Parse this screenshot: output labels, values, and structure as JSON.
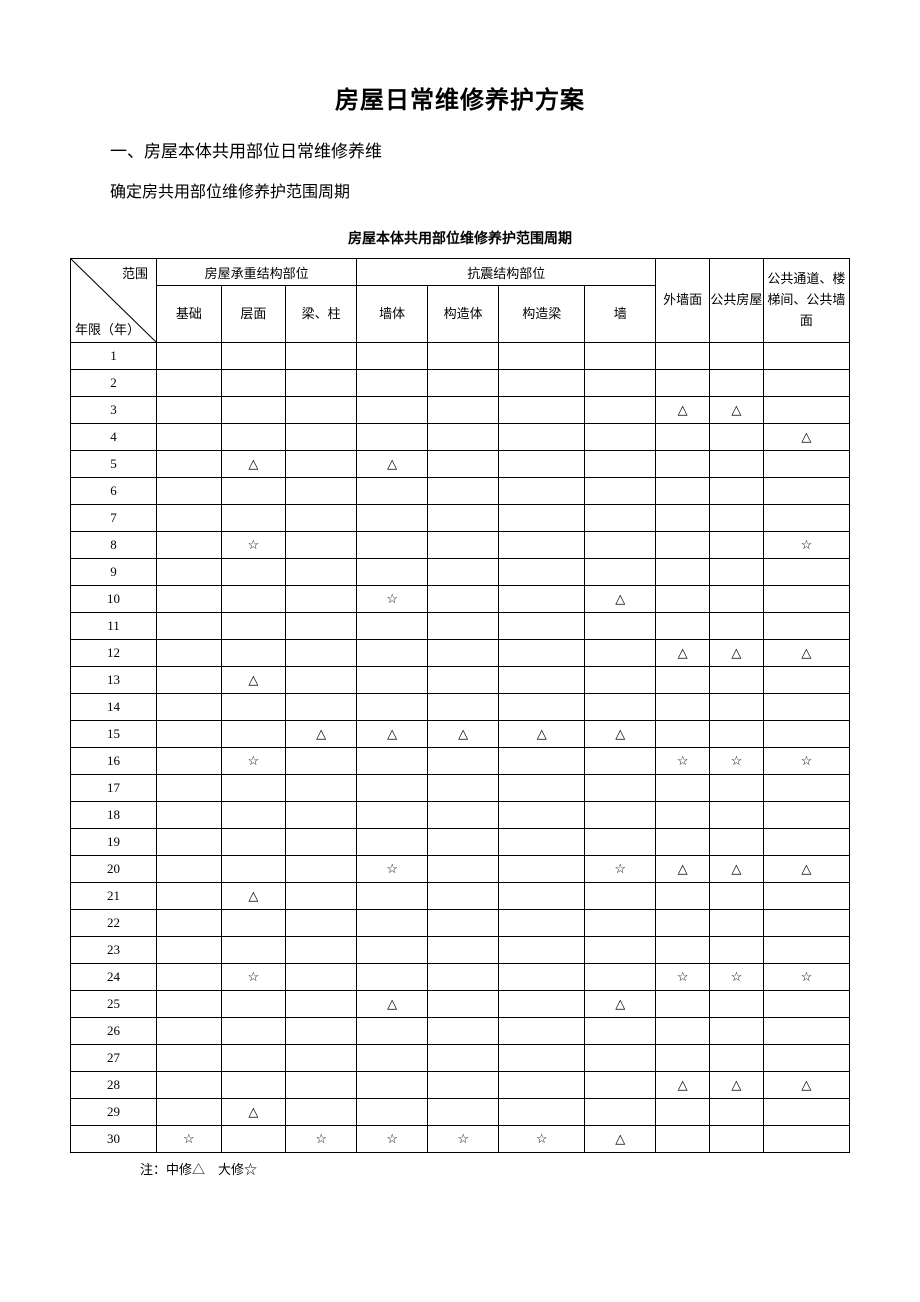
{
  "title": "房屋日常维修养护方案",
  "section_heading": "一、房屋本体共用部位日常维修养维",
  "subtext": "确定房共用部位维修养护范围周期",
  "table_caption": "房屋本体共用部位维修养护范围周期",
  "diag": {
    "top": "范围",
    "bottom": "年限（年）"
  },
  "header_groups": {
    "g1": "房屋承重结构部位",
    "g2": "抗震结构部位"
  },
  "columns": {
    "c1": "基础",
    "c2": "层面",
    "c3": "梁、柱",
    "c4": "墙体",
    "c5": "构造体",
    "c6": "构造梁",
    "c7": "墙",
    "c8": "外墙面",
    "c9": "公共房屋",
    "c10": "公共通道、楼梯间、公共墙面"
  },
  "symbols": {
    "mid": "△",
    "big": "☆"
  },
  "legend": "注：中修△    大修☆",
  "chart_data": {
    "type": "table",
    "legend": {
      "△": "中修",
      "☆": "大修"
    },
    "columns": [
      "基础",
      "层面",
      "梁、柱",
      "墙体",
      "构造体",
      "构造梁",
      "墙",
      "外墙面",
      "公共房屋",
      "公共通道、楼梯间、公共墙面"
    ],
    "rows": [
      {
        "year": 1,
        "cells": [
          "",
          "",
          "",
          "",
          "",
          "",
          "",
          "",
          "",
          ""
        ]
      },
      {
        "year": 2,
        "cells": [
          "",
          "",
          "",
          "",
          "",
          "",
          "",
          "",
          "",
          ""
        ]
      },
      {
        "year": 3,
        "cells": [
          "",
          "",
          "",
          "",
          "",
          "",
          "",
          "△",
          "△",
          ""
        ]
      },
      {
        "year": 4,
        "cells": [
          "",
          "",
          "",
          "",
          "",
          "",
          "",
          "",
          "",
          "△"
        ]
      },
      {
        "year": 5,
        "cells": [
          "",
          "△",
          "",
          "△",
          "",
          "",
          "",
          "",
          "",
          ""
        ]
      },
      {
        "year": 6,
        "cells": [
          "",
          "",
          "",
          "",
          "",
          "",
          "",
          "",
          "",
          ""
        ]
      },
      {
        "year": 7,
        "cells": [
          "",
          "",
          "",
          "",
          "",
          "",
          "",
          "",
          "",
          ""
        ]
      },
      {
        "year": 8,
        "cells": [
          "",
          "☆",
          "",
          "",
          "",
          "",
          "",
          "",
          "",
          "☆"
        ]
      },
      {
        "year": 9,
        "cells": [
          "",
          "",
          "",
          "",
          "",
          "",
          "",
          "",
          "",
          ""
        ]
      },
      {
        "year": 10,
        "cells": [
          "",
          "",
          "",
          "☆",
          "",
          "",
          "△",
          "",
          "",
          ""
        ]
      },
      {
        "year": 11,
        "cells": [
          "",
          "",
          "",
          "",
          "",
          "",
          "",
          "",
          "",
          ""
        ]
      },
      {
        "year": 12,
        "cells": [
          "",
          "",
          "",
          "",
          "",
          "",
          "",
          "△",
          "△",
          "△"
        ]
      },
      {
        "year": 13,
        "cells": [
          "",
          "△",
          "",
          "",
          "",
          "",
          "",
          "",
          "",
          ""
        ]
      },
      {
        "year": 14,
        "cells": [
          "",
          "",
          "",
          "",
          "",
          "",
          "",
          "",
          "",
          ""
        ]
      },
      {
        "year": 15,
        "cells": [
          "",
          "",
          "△",
          "△",
          "△",
          "△",
          "△",
          "",
          "",
          ""
        ]
      },
      {
        "year": 16,
        "cells": [
          "",
          "☆",
          "",
          "",
          "",
          "",
          "",
          "☆",
          "☆",
          "☆"
        ]
      },
      {
        "year": 17,
        "cells": [
          "",
          "",
          "",
          "",
          "",
          "",
          "",
          "",
          "",
          ""
        ]
      },
      {
        "year": 18,
        "cells": [
          "",
          "",
          "",
          "",
          "",
          "",
          "",
          "",
          "",
          ""
        ]
      },
      {
        "year": 19,
        "cells": [
          "",
          "",
          "",
          "",
          "",
          "",
          "",
          "",
          "",
          ""
        ]
      },
      {
        "year": 20,
        "cells": [
          "",
          "",
          "",
          "☆",
          "",
          "",
          "☆",
          "△",
          "△",
          "△"
        ]
      },
      {
        "year": 21,
        "cells": [
          "",
          "△",
          "",
          "",
          "",
          "",
          "",
          "",
          "",
          ""
        ]
      },
      {
        "year": 22,
        "cells": [
          "",
          "",
          "",
          "",
          "",
          "",
          "",
          "",
          "",
          ""
        ]
      },
      {
        "year": 23,
        "cells": [
          "",
          "",
          "",
          "",
          "",
          "",
          "",
          "",
          "",
          ""
        ]
      },
      {
        "year": 24,
        "cells": [
          "",
          "☆",
          "",
          "",
          "",
          "",
          "",
          "☆",
          "☆",
          "☆"
        ]
      },
      {
        "year": 25,
        "cells": [
          "",
          "",
          "",
          "△",
          "",
          "",
          "△",
          "",
          "",
          ""
        ]
      },
      {
        "year": 26,
        "cells": [
          "",
          "",
          "",
          "",
          "",
          "",
          "",
          "",
          "",
          ""
        ]
      },
      {
        "year": 27,
        "cells": [
          "",
          "",
          "",
          "",
          "",
          "",
          "",
          "",
          "",
          ""
        ]
      },
      {
        "year": 28,
        "cells": [
          "",
          "",
          "",
          "",
          "",
          "",
          "",
          "△",
          "△",
          "△"
        ]
      },
      {
        "year": 29,
        "cells": [
          "",
          "△",
          "",
          "",
          "",
          "",
          "",
          "",
          "",
          ""
        ]
      },
      {
        "year": 30,
        "cells": [
          "☆",
          "",
          "☆",
          "☆",
          "☆",
          "☆",
          "△",
          "",
          "",
          ""
        ]
      }
    ]
  }
}
